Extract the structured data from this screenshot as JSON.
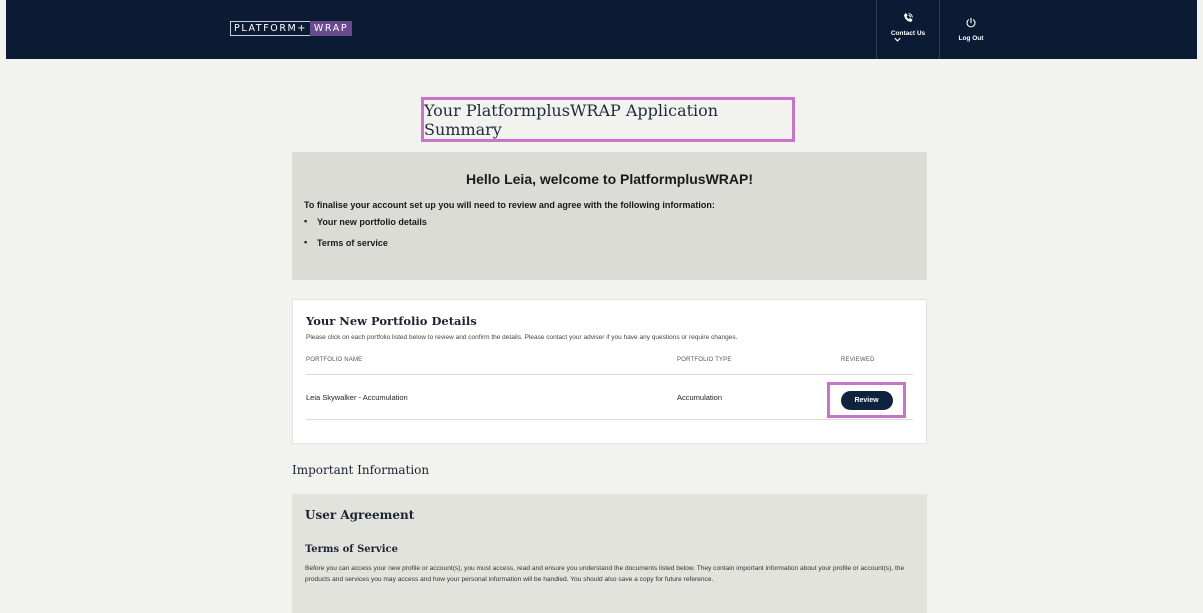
{
  "header": {
    "logo_left": "PLATFORM+",
    "logo_right": "WRAP",
    "contact_label": "Contact Us",
    "logout_label": "Log Out"
  },
  "page_title": "Your PlatformplusWRAP Application Summary",
  "welcome": {
    "heading": "Hello Leia, welcome to PlatformplusWRAP!",
    "intro": "To finalise your account set up you will need to review and agree with the following information:",
    "items": [
      "Your new portfolio details",
      "Terms of service"
    ]
  },
  "portfolio": {
    "title": "Your New Portfolio Details",
    "description": "Please click on each portfolio listed below to review and confirm the details. Please contact your adviser if you have any questions or require changes.",
    "columns": [
      "PORTFOLIO NAME",
      "PORTFOLIO TYPE",
      "REVIEWED"
    ],
    "rows": [
      {
        "name": "Leia Skywalker - Accumulation",
        "type": "Accumulation",
        "action": "Review"
      }
    ]
  },
  "important_heading": "Important Information",
  "agreement": {
    "title": "User Agreement",
    "subtitle": "Terms of Service",
    "body": "Before you can access your new profile or account(s), you must access, read and ensure you understand the documents listed below. They contain important information about your profile or account(s), the products and services you may access and how your personal information will be handled. You should also save a copy for future reference."
  },
  "colors": {
    "header_bg": "#0b1b33",
    "highlight": "#c774c9",
    "button_bg": "#10233d",
    "logo_accent": "#6a4a8e"
  }
}
